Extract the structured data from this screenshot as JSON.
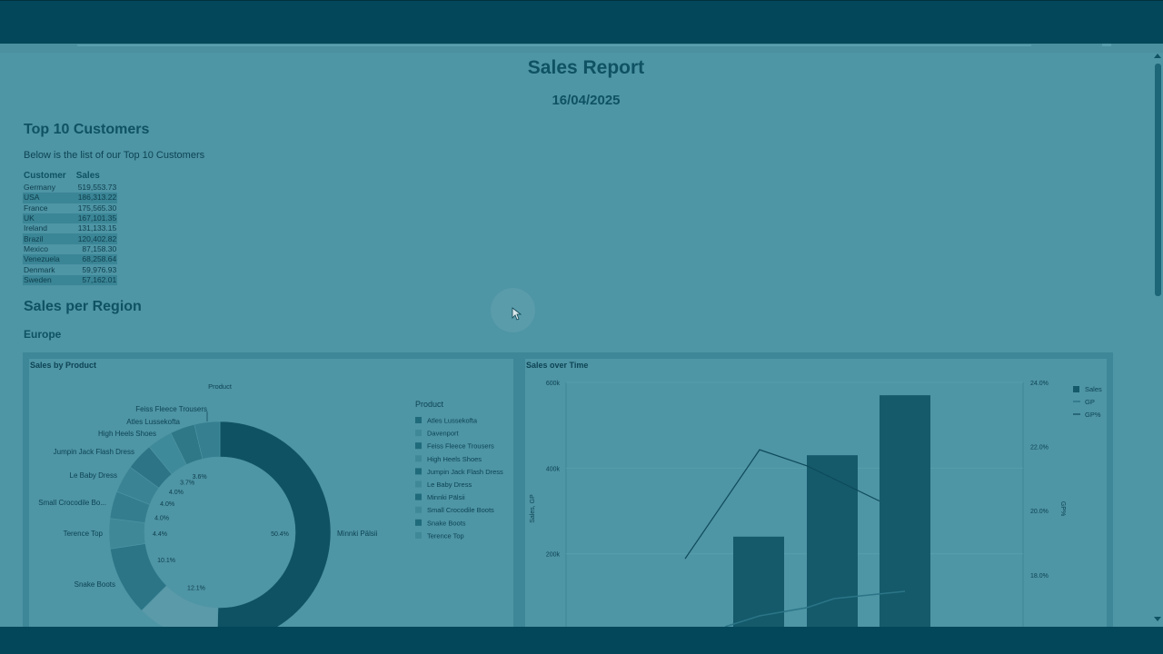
{
  "report": {
    "title": "Sales Report",
    "date": "16/04/2025"
  },
  "customers": {
    "heading": "Top 10 Customers",
    "description": "Below is the list of our Top 10 Customers",
    "columns": [
      "Customer",
      "Sales"
    ],
    "rows": [
      [
        "Germany",
        "519,553.73"
      ],
      [
        "USA",
        "186,313.22"
      ],
      [
        "France",
        "175,565.30"
      ],
      [
        "UK",
        "167,101.35"
      ],
      [
        "Ireland",
        "131,133.15"
      ],
      [
        "Brazil",
        "120,402.82"
      ],
      [
        "Mexico",
        "87,158.30"
      ],
      [
        "Venezuela",
        "68,258.64"
      ],
      [
        "Denmark",
        "59,976.93"
      ],
      [
        "Sweden",
        "57,162.01"
      ]
    ]
  },
  "region": {
    "heading": "Sales per Region",
    "subheading": "Europe"
  },
  "colors": {
    "dark": "#0e5264",
    "mid": "#2b7587",
    "light": "#5b9aa8",
    "panel": "#4e95a5"
  },
  "chart_data": [
    {
      "type": "pie",
      "title": "Sales by Product",
      "dimension_label": "Product",
      "legend_title": "Product",
      "legend": [
        "Atles Lussekofta",
        "Davenport",
        "Feiss Fleece Trousers",
        "High Heels Shoes",
        "Jumpin Jack Flash Dress",
        "Le Baby Dress",
        "Minnki Pälsii",
        "Small Crocodile Boots",
        "Snake Boots",
        "Terence Top"
      ],
      "slices": [
        {
          "label": "Minnki Pälsii",
          "value": 50.4,
          "text": "50.4%"
        },
        {
          "label": "",
          "value": 12.1,
          "text": "12.1%"
        },
        {
          "label": "Snake Boots",
          "value": 10.1,
          "text": "10.1%"
        },
        {
          "label": "Terence Top",
          "value": 4.4,
          "text": "4.4%"
        },
        {
          "label": "Small Crocodile Bo...",
          "value": 4.0,
          "text": "4.0%"
        },
        {
          "label": "Le Baby Dress",
          "value": 4.0,
          "text": "4.0%"
        },
        {
          "label": "Jumpin Jack Flash Dress",
          "value": 4.0,
          "text": "4.0%"
        },
        {
          "label": "High Heels Shoes",
          "value": 3.7,
          "text": "3.7%"
        },
        {
          "label": "Atles Lussekofta",
          "value": 3.6,
          "text": "3.6%"
        },
        {
          "label": "Feiss Fleece Trousers",
          "value": 3.7,
          "text": ""
        }
      ]
    },
    {
      "type": "bar",
      "title": "Sales over Time",
      "ylabel": "Sales, GP",
      "y2label": "GP%",
      "y_ticks": [
        "600k",
        "400k",
        "200k"
      ],
      "y2_ticks": [
        "24.0%",
        "22.0%",
        "20.0%",
        "18.0%"
      ],
      "ylim": [
        0,
        600000
      ],
      "y2lim": [
        16.8,
        24
      ],
      "legend": [
        "Sales",
        "GP",
        "GP%"
      ],
      "bars": [
        240000,
        430000,
        570000
      ],
      "gp": [
        0,
        30000,
        60000,
        80000,
        88000
      ],
      "gp_pct": [
        18.5,
        21.9,
        21.4,
        20.3
      ]
    }
  ]
}
